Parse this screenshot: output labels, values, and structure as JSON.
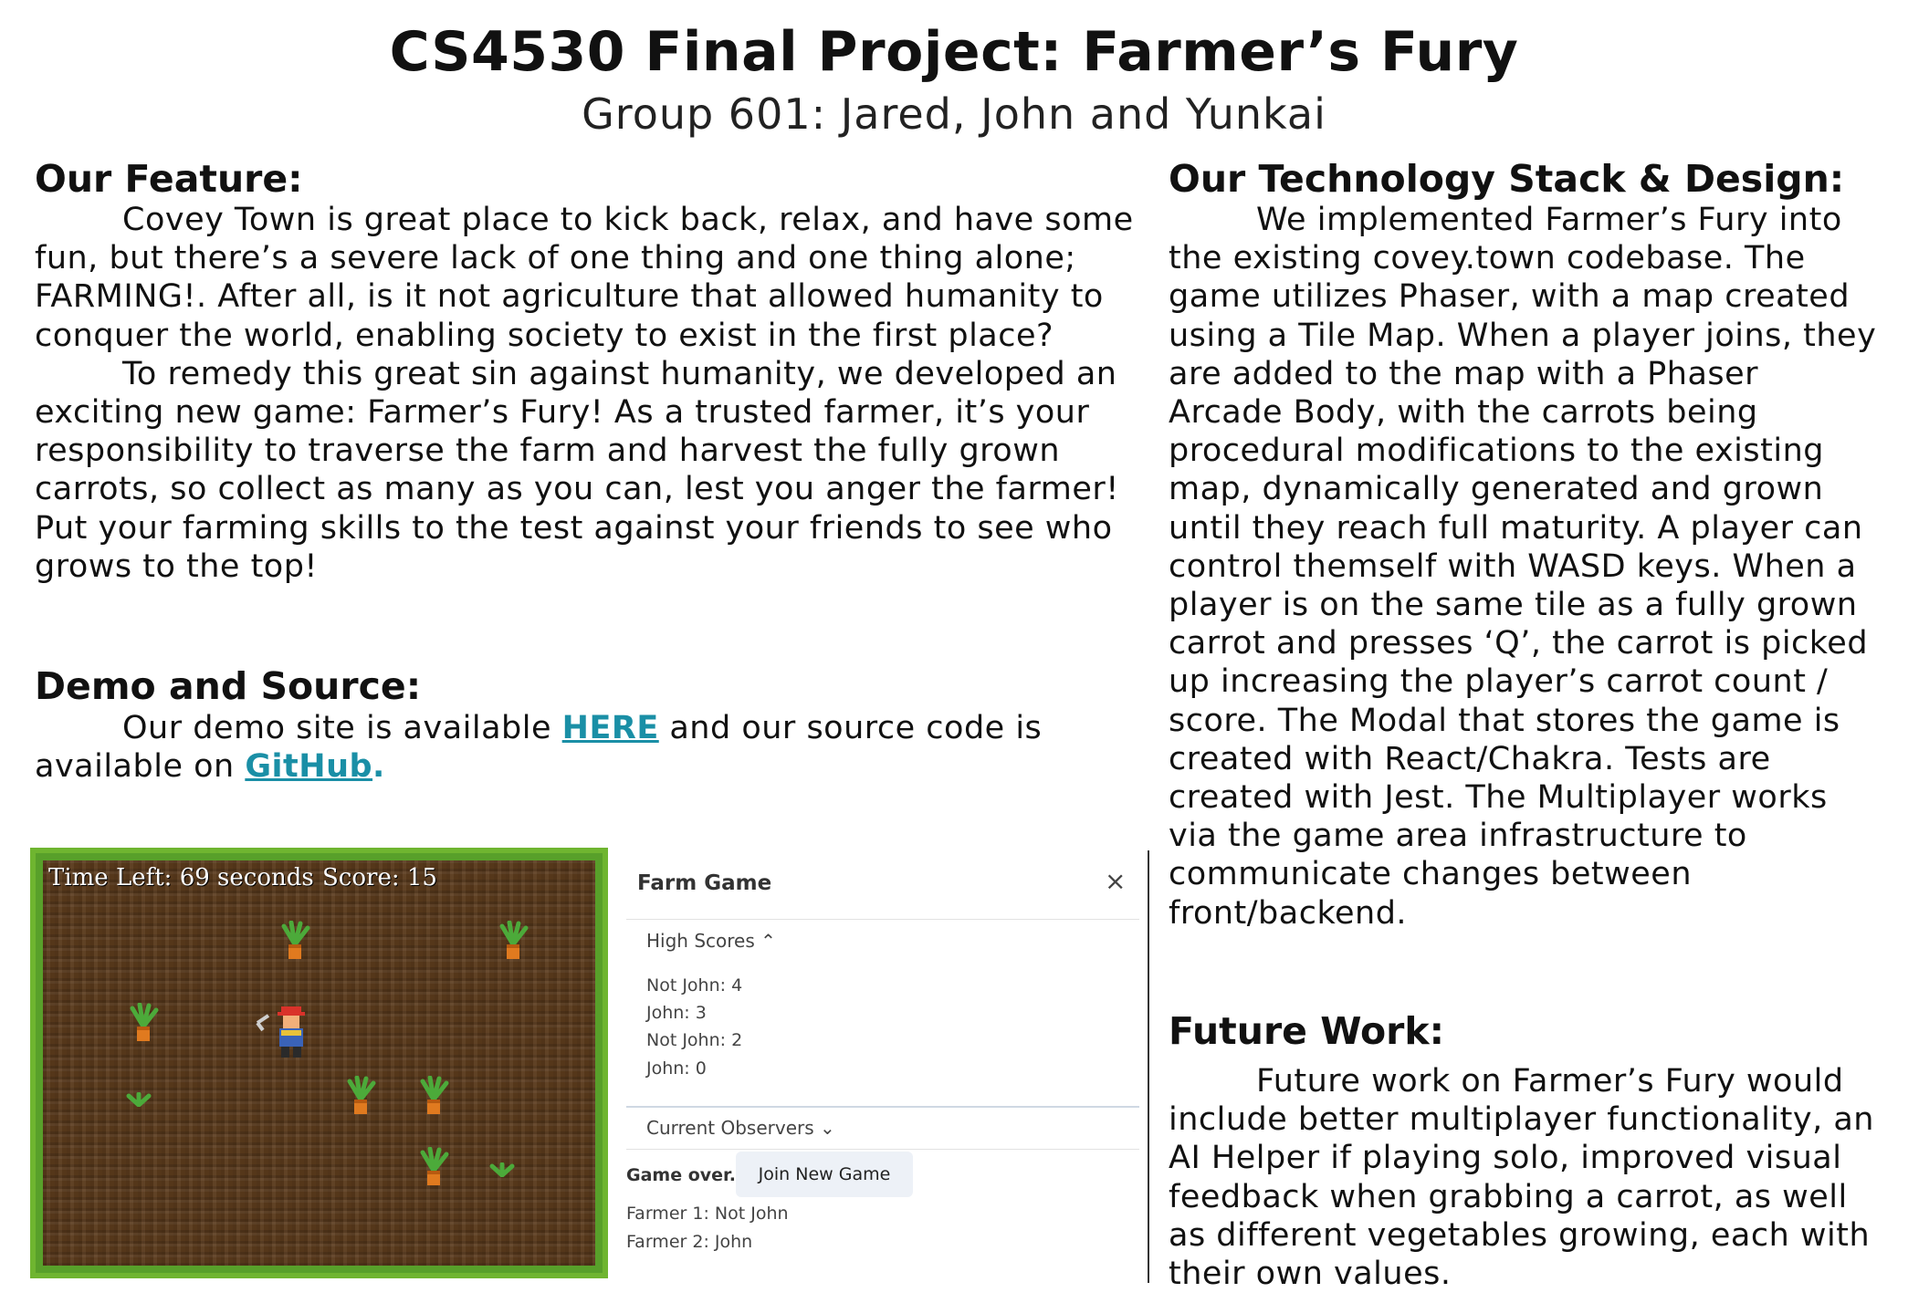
{
  "header": {
    "title": "CS4530 Final Project: Farmer’s Fury",
    "subtitle": "Group 601: Jared, John and Yunkai"
  },
  "feature": {
    "heading": "Our Feature:",
    "para1": "Covey Town is great place to kick back, relax, and have some fun, but there’s a severe lack of one thing and one thing alone; FARMING!. After all, is it not agriculture that allowed humanity to conquer the world, enabling society to exist in the first place?",
    "para2": "To remedy this great sin against humanity, we developed an exciting new game: Farmer’s Fury! As a trusted farmer, it’s your responsibility to traverse the farm and harvest the fully grown carrots, so collect as many as you can, lest you anger the farmer! Put your farming skills to the test against your friends to see who grows to the top!"
  },
  "demo": {
    "heading": "Demo and Source:",
    "text_before": "Our demo site is available ",
    "link1": "HERE",
    "text_middle": " and our source code is available on ",
    "link2": "GitHub",
    "text_after": "."
  },
  "tech": {
    "heading": "Our Technology Stack & Design:",
    "para": "We implemented Farmer’s Fury into the existing covey.town codebase. The game utilizes Phaser, with a map created using a Tile Map. When a player joins, they are added to the map with a Phaser Arcade Body, with the carrots being procedural modifications to the existing map, dynamically generated and grown until they reach full maturity. A player can control themself with WASD keys. When a player is on the same tile as a fully grown carrot and presses ‘Q’, the carrot is picked up increasing the player’s carrot count / score. The Modal that stores the game is created with React/Chakra. Tests are created with Jest. The Multiplayer works via the game area infrastructure to communicate changes between front/backend."
  },
  "future": {
    "heading": "Future Work:",
    "para": "Future work on Farmer’s Fury would include better multiplayer functionality, an AI Helper if playing solo, improved visual feedback when grabbing a carrot, as well as different vegetables growing, each with their own values."
  },
  "game": {
    "time_left": "Time Left: 69 seconds",
    "score": "Score: 15"
  },
  "modal": {
    "title": "Farm Game",
    "close_icon": "close-icon",
    "high_scores_label": "High Scores ⌃",
    "high_scores": [
      "Not John: 4",
      "John: 3",
      "Not John: 2",
      "John: 0"
    ],
    "observers_label": "Current Observers ⌄",
    "game_over": "Game over.",
    "join_button": "Join New Game",
    "farmers": [
      "Farmer 1: Not John",
      "Farmer 2: John"
    ]
  },
  "colors": {
    "link": "#1a8fa6",
    "grass": "#6fb530",
    "soil": "#5a3a1c",
    "carrot": "#e07a1f",
    "leaf": "#4caa3a"
  }
}
